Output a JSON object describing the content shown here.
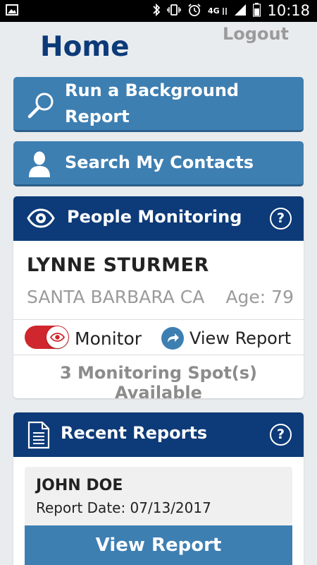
{
  "status_bar": {
    "time": "10:18",
    "network_label": "4G",
    "left_icon": "image-icon",
    "right_icons": [
      "bluetooth-icon",
      "vibrate-icon",
      "alarm-icon",
      "lte-signal-icon",
      "signal-icon",
      "battery-icon"
    ]
  },
  "header": {
    "title": "Home",
    "logout_label": "Logout"
  },
  "actions": {
    "background_report_label": "Run a Background Report",
    "background_report_icon": "search-icon",
    "search_contacts_label": "Search My Contacts",
    "search_contacts_icon": "person-icon"
  },
  "people_monitoring": {
    "header_label": "People Monitoring",
    "header_icon": "eye-icon",
    "help_label": "?",
    "person": {
      "name": "LYNNE STURMER",
      "location": "SANTA BARBARA CA",
      "age": "Age: 79"
    },
    "monitor_label": "Monitor",
    "monitor_on": true,
    "view_report_label": "View Report",
    "spots_text": "3 Monitoring Spot(s) Available"
  },
  "recent_reports": {
    "header_label": "Recent Reports",
    "header_icon": "document-icon",
    "help_label": "?",
    "items": [
      {
        "name": "JOHN DOE",
        "report_date": "Report Date: 07/13/2017",
        "button_label": "View Report"
      }
    ]
  },
  "colors": {
    "brand_navy": "#0d3a78",
    "action_blue": "#3e7fb2",
    "toggle_red": "#d0262d",
    "muted_gray": "#9b9b9b",
    "background": "#e9ecef"
  }
}
